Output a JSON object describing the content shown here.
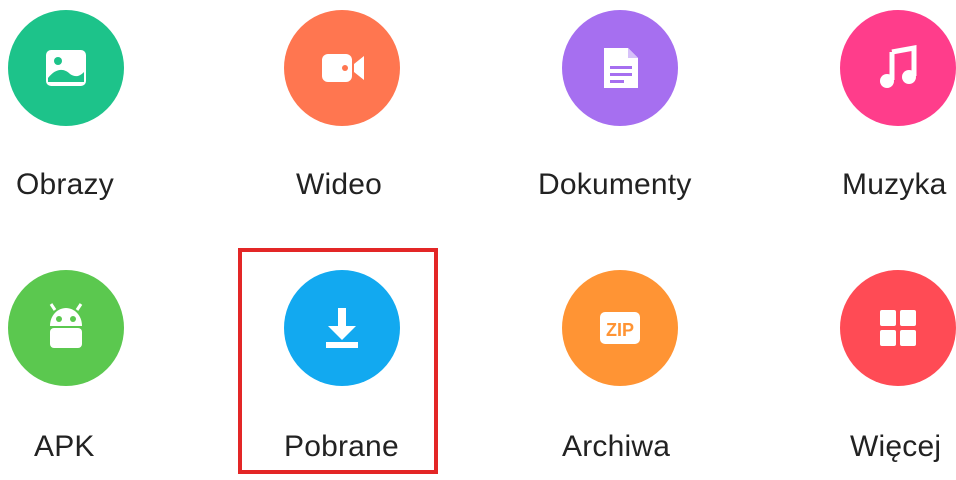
{
  "categories": [
    {
      "id": "images",
      "label": "Obrazy",
      "icon": "image-icon",
      "color": "#1dc38a"
    },
    {
      "id": "video",
      "label": "Wideo",
      "icon": "video-camera-icon",
      "color": "#ff7650"
    },
    {
      "id": "documents",
      "label": "Dokumenty",
      "icon": "document-icon",
      "color": "#a66ff0"
    },
    {
      "id": "music",
      "label": "Muzyka",
      "icon": "music-note-icon",
      "color": "#ff3d8b"
    },
    {
      "id": "apk",
      "label": "APK",
      "icon": "android-icon",
      "color": "#5bc84f"
    },
    {
      "id": "downloads",
      "label": "Pobrane",
      "icon": "download-icon",
      "color": "#12a9f0"
    },
    {
      "id": "archives",
      "label": "Archiwa",
      "icon": "zip-archive-icon",
      "color": "#ff9434",
      "icon_text": "ZIP"
    },
    {
      "id": "more",
      "label": "Więcej",
      "icon": "grid-icon",
      "color": "#ff4b55"
    }
  ],
  "highlight_color": "#e32626"
}
